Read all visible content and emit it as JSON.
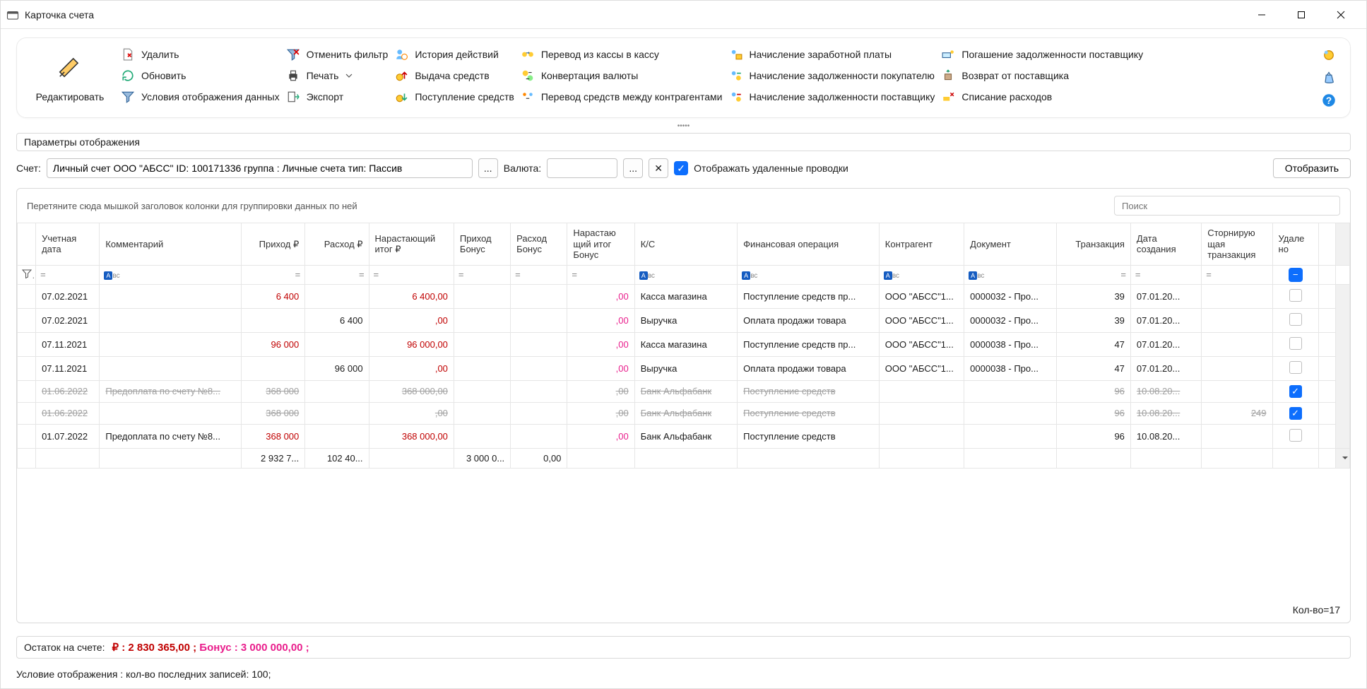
{
  "title": "Карточка счета",
  "ribbon": {
    "primary": "Редактировать",
    "col1": [
      "Удалить",
      "Обновить",
      "Условия отображения данных"
    ],
    "col2_0": "Отменить фильтр",
    "col2_1": "Печать",
    "col2_2": "Экспорт",
    "col3": [
      "История действий",
      "Выдача средств",
      "Поступление средств"
    ],
    "col4": [
      "Перевод из кассы в кассу",
      "Конвертация валюты",
      "Перевод средств между контрагентами"
    ],
    "col5": [
      "Начисление заработной платы",
      "Начисление задолженности покупателю",
      "Начисление задолженности поставщику"
    ],
    "col6": [
      "Погашение задолженности поставщику",
      "Возврат от поставщика",
      "Списание расходов"
    ]
  },
  "params": {
    "header": "Параметры отображения",
    "account_label": "Счет:",
    "account_value": "Личный счет ООО \"АБСС\" ID: 100171336 группа : Личные счета тип: Пассив",
    "currency_label": "Валюта:",
    "show_deleted_label": "Отображать удаленные проводки",
    "display_btn": "Отобразить"
  },
  "grid": {
    "group_hint": "Перетяните сюда мышкой заголовок колонки для группировки данных по ней",
    "search_placeholder": "Поиск",
    "headers": {
      "date": "Учетная дата",
      "comment": "Комментарий",
      "income": "Приход ₽",
      "expense": "Расход ₽",
      "running": "Нарастающий итог ₽",
      "bonus_in": "Приход Бонус",
      "bonus_out": "Расход Бонус",
      "bonus_running": "Нарастаю щий итог Бонус",
      "ks": "К/С",
      "fin_op": "Финансовая операция",
      "counterparty": "Контрагент",
      "document": "Документ",
      "transaction": "Транзакция",
      "created": "Дата создания",
      "reversing": "Сторнирую щая транзакция",
      "deleted": "Удале но"
    },
    "rows": [
      {
        "date": "07.02.2021",
        "comment": "",
        "income": "6 400",
        "expense": "",
        "running": "6 400,00",
        "bonus_run": ",00",
        "ks": "Касса магазина",
        "fin_op": "Поступление средств пр...",
        "cp": "ООО \"АБСС\"1...",
        "doc": "0000032 - Про...",
        "tx": "39",
        "created": "07.01.20...",
        "rev": "",
        "deleted": false,
        "strike": false
      },
      {
        "date": "07.02.2021",
        "comment": "",
        "income": "",
        "expense": "6 400",
        "running": ",00",
        "bonus_run": ",00",
        "ks": "Выручка",
        "fin_op": "Оплата продажи товара",
        "cp": "ООО \"АБСС\"1...",
        "doc": "0000032 - Про...",
        "tx": "39",
        "created": "07.01.20...",
        "rev": "",
        "deleted": false,
        "strike": false
      },
      {
        "date": "07.11.2021",
        "comment": "",
        "income": "96 000",
        "expense": "",
        "running": "96 000,00",
        "bonus_run": ",00",
        "ks": "Касса магазина",
        "fin_op": "Поступление средств пр...",
        "cp": "ООО \"АБСС\"1...",
        "doc": "0000038 - Про...",
        "tx": "47",
        "created": "07.01.20...",
        "rev": "",
        "deleted": false,
        "strike": false
      },
      {
        "date": "07.11.2021",
        "comment": "",
        "income": "",
        "expense": "96 000",
        "running": ",00",
        "bonus_run": ",00",
        "ks": "Выручка",
        "fin_op": "Оплата продажи товара",
        "cp": "ООО \"АБСС\"1...",
        "doc": "0000038 - Про...",
        "tx": "47",
        "created": "07.01.20...",
        "rev": "",
        "deleted": false,
        "strike": false
      },
      {
        "date": "01.06.2022",
        "comment": "Предоплата по счету №8...",
        "income": "  368 000",
        "expense": "",
        "running": "  368 000,00",
        "bonus_run": "  ,00",
        "ks": "Банк Альфабанк",
        "fin_op": "Поступление средств",
        "cp": "",
        "doc": "",
        "tx": "96",
        "created": "10.08.20...",
        "rev": "",
        "deleted": true,
        "strike": true
      },
      {
        "date": "01.06.2022",
        "comment": "",
        "income": "  368 000",
        "expense": "",
        "running": "  ,00",
        "bonus_run": "  ,00",
        "ks": "Банк Альфабанк",
        "fin_op": "Поступление средств",
        "cp": "",
        "doc": "",
        "tx": "96",
        "created": "10.08.20...",
        "rev": "249",
        "deleted": true,
        "strike": true
      },
      {
        "date": "01.07.2022",
        "comment": "Предоплата по счету №8...",
        "income": "368 000",
        "expense": "",
        "running": "368 000,00",
        "bonus_run": ",00",
        "ks": "Банк Альфабанк",
        "fin_op": "Поступление средств",
        "cp": "",
        "doc": "",
        "tx": "96",
        "created": "10.08.20...",
        "rev": "",
        "deleted": false,
        "strike": false
      }
    ],
    "totals": {
      "income": "2 932 7...",
      "expense": "102 40...",
      "bonus_in": "3 000 0...",
      "bonus_out": "0,00"
    },
    "count": "Кол-во=17"
  },
  "balance": {
    "label": "Остаток на счете:",
    "rub": "₽ : 2 830 365,00 ;",
    "bonus": "Бонус : 3 000 000,00 ;"
  },
  "condition": "Условие отображения  :  кол-во последних записей: 100;"
}
